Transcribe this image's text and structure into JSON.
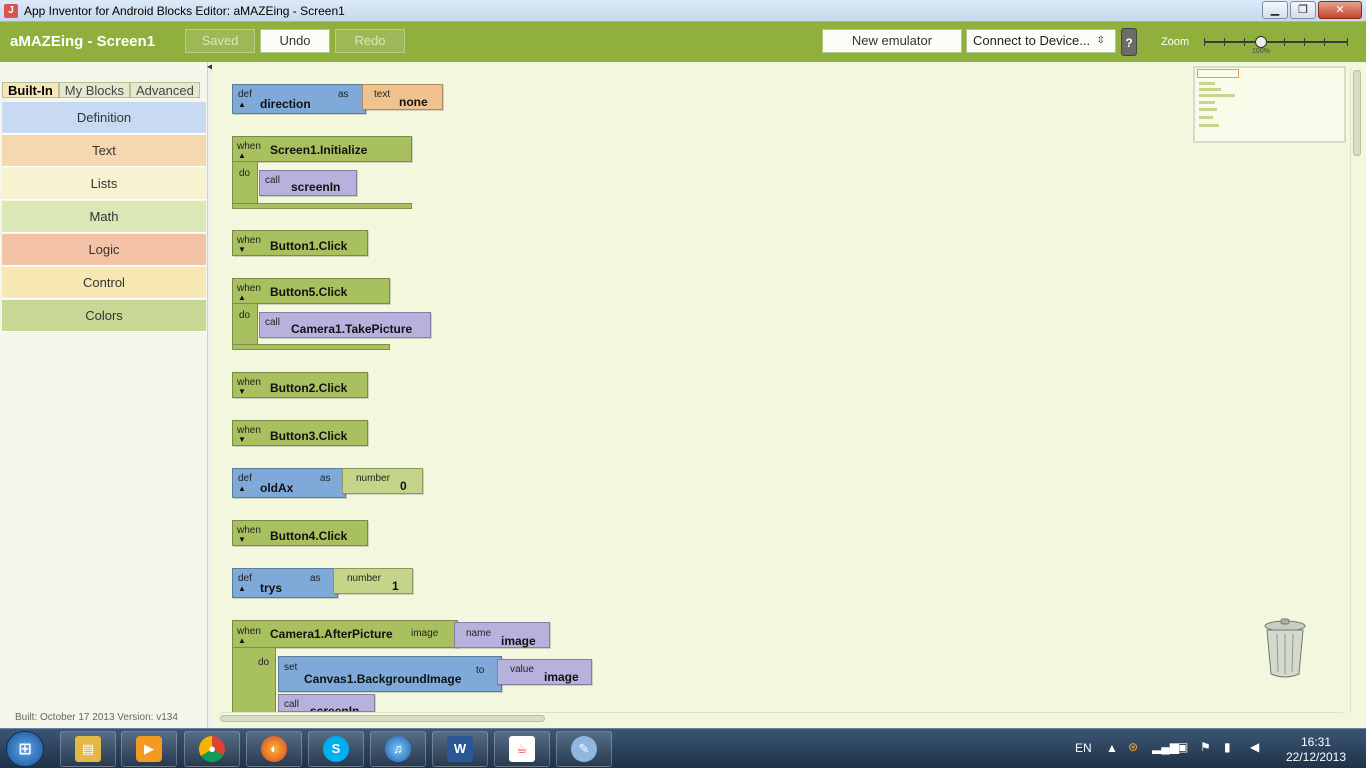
{
  "window": {
    "title": "App Inventor for Android Blocks Editor: aMAZEing - Screen1",
    "minimize": "▁",
    "maximize": "❐",
    "close": "✕"
  },
  "toolbar": {
    "project": "aMAZEing - Screen1",
    "saved": "Saved",
    "undo": "Undo",
    "redo": "Redo",
    "new_emulator": "New emulator",
    "connect": "Connect to Device...",
    "help": "?",
    "zoom_label": "Zoom",
    "zoom_value": "100%"
  },
  "sidebar": {
    "tabs": [
      "Built-In",
      "My Blocks",
      "Advanced"
    ],
    "drawers": [
      {
        "label": "Definition",
        "color": "#c7daf1"
      },
      {
        "label": "Text",
        "color": "#f5d7b0"
      },
      {
        "label": "Lists",
        "color": "#f7f3d0"
      },
      {
        "label": "Math",
        "color": "#dbe8b6"
      },
      {
        "label": "Logic",
        "color": "#f4c2a6"
      },
      {
        "label": "Control",
        "color": "#f6e7b3"
      },
      {
        "label": "Colors",
        "color": "#c6d894"
      }
    ],
    "build_info": "Built: October 17 2013 Version: v134"
  },
  "blocks": {
    "def1": {
      "def": "def",
      "name": "direction",
      "as": "as",
      "kind": "text",
      "value": "none"
    },
    "init": {
      "when": "when",
      "event": "Screen1.Initialize",
      "do": "do",
      "call": "call",
      "proc": "screenIn"
    },
    "b1": {
      "when": "when",
      "event": "Button1.Click"
    },
    "b5": {
      "when": "when",
      "event": "Button5.Click",
      "do": "do",
      "call": "call",
      "proc": "Camera1.TakePicture"
    },
    "b2": {
      "when": "when",
      "event": "Button2.Click"
    },
    "b3": {
      "when": "when",
      "event": "Button3.Click"
    },
    "def2": {
      "def": "def",
      "name": "oldAx",
      "as": "as",
      "kind": "number",
      "value": "0"
    },
    "b4": {
      "when": "when",
      "event": "Button4.Click"
    },
    "def3": {
      "def": "def",
      "name": "trys",
      "as": "as",
      "kind": "number",
      "value": "1"
    },
    "cam": {
      "when": "when",
      "event": "Camera1.AfterPicture",
      "param": "image",
      "name_kw": "name",
      "name_val": "image",
      "do": "do",
      "set": "set",
      "target": "Canvas1.BackgroundImage",
      "to": "to",
      "value_kw": "value",
      "value_val": "image",
      "call": "call",
      "proc": "screenIn"
    }
  },
  "taskbar": {
    "lang": "EN",
    "time": "16:31",
    "date": "22/12/2013"
  }
}
